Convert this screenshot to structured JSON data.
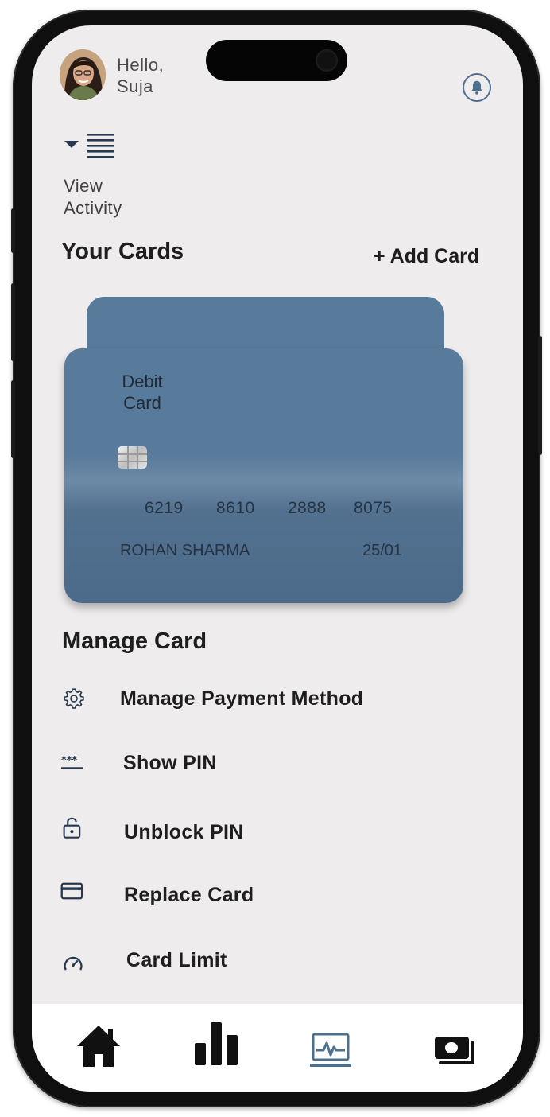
{
  "header": {
    "greeting_line1": "Hello,",
    "greeting_line2": "Suja",
    "avatar_icon": "user-avatar",
    "notification_icon": "bell-icon"
  },
  "activity": {
    "line1": "View",
    "line2": "Activity",
    "icon": "dropdown-list-icon"
  },
  "cards_section": {
    "title": "Your Cards",
    "add_label": "+ Add Card"
  },
  "card": {
    "type_line1": "Debit",
    "type_line2": "Card",
    "number_groups": [
      "6219",
      "8610",
      "2888",
      "8075"
    ],
    "holder": "ROHAN SHARMA",
    "expiry": "25/01",
    "color": "#587a9b"
  },
  "manage": {
    "title": "Manage Card",
    "items": [
      {
        "label": "Manage Payment Method",
        "icon": "gear-icon"
      },
      {
        "label": "Show PIN",
        "icon": "asterisk-pin-icon"
      },
      {
        "label": "Unblock PIN",
        "icon": "unlock-icon"
      },
      {
        "label": "Replace Card",
        "icon": "card-icon"
      },
      {
        "label": "Card Limit",
        "icon": "speedometer-icon"
      }
    ]
  },
  "bottom_nav": {
    "items": [
      {
        "icon": "home-icon",
        "active": false
      },
      {
        "icon": "bar-chart-icon",
        "active": false
      },
      {
        "icon": "activity-monitor-icon",
        "active": true
      },
      {
        "icon": "wallet-cash-icon",
        "active": false
      }
    ],
    "active_color": "#4d6f90"
  }
}
